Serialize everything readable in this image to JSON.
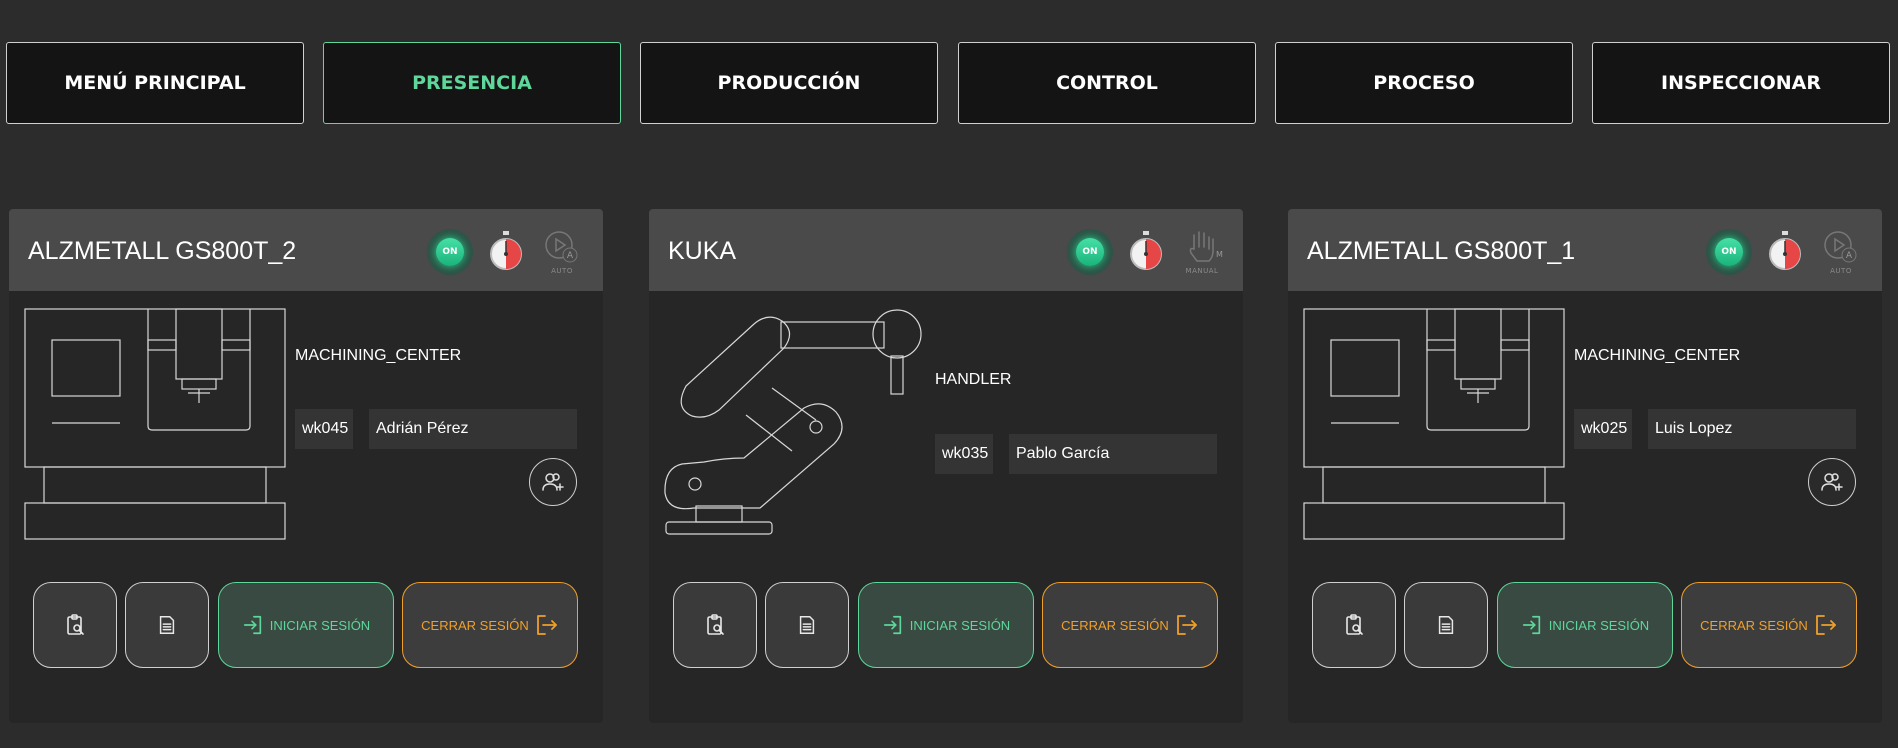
{
  "nav": {
    "items": [
      {
        "label": "MENÚ PRINCIPAL",
        "active": false
      },
      {
        "label": "PRESENCIA",
        "active": true
      },
      {
        "label": "PRODUCCIÓN",
        "active": false
      },
      {
        "label": "CONTROL",
        "active": false
      },
      {
        "label": "PROCESO",
        "active": false
      },
      {
        "label": "INSPECCIONAR",
        "active": false
      }
    ]
  },
  "colors": {
    "accent_green": "#5fd69a",
    "accent_orange": "#f0a02a",
    "background": "#2c2c2c",
    "card": "#262626",
    "card_header": "#4a4a4a"
  },
  "cards": [
    {
      "title": "ALZMETALL GS800T_2",
      "status": "ON",
      "mode": "AUTO",
      "mode_icon": "play-auto-icon",
      "machine_type": "MACHINING_CENTER",
      "worker_id": "wk045",
      "worker_name": "Adrián Pérez",
      "login_label": "INICIAR SESIÓN",
      "logout_label": "CERRAR SESIÓN"
    },
    {
      "title": "KUKA",
      "status": "ON",
      "mode": "MANUAL",
      "mode_icon": "hand-manual-icon",
      "machine_type": "HANDLER",
      "worker_id": "wk035",
      "worker_name": "Pablo García",
      "login_label": "INICIAR SESIÓN",
      "logout_label": "CERRAR SESIÓN"
    },
    {
      "title": "ALZMETALL GS800T_1",
      "status": "ON",
      "mode": "AUTO",
      "mode_icon": "play-auto-icon",
      "machine_type": "MACHINING_CENTER",
      "worker_id": "wk025",
      "worker_name": "Luis Lopez",
      "login_label": "INICIAR SESIÓN",
      "logout_label": "CERRAR SESIÓN"
    }
  ]
}
